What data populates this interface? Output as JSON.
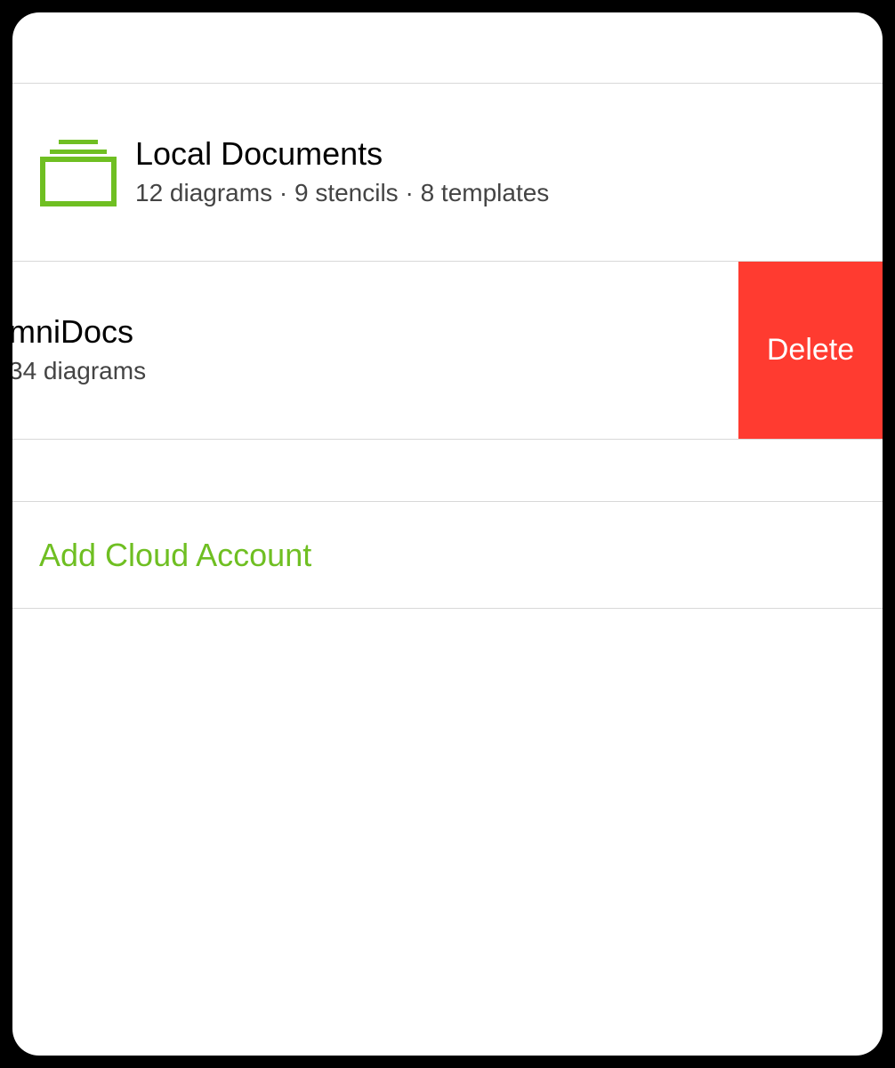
{
  "locations": {
    "local": {
      "title": "Local Documents",
      "subtitle": "12 diagrams · 9 stencils · 8 templates"
    },
    "swiped": {
      "title": "mniDocs",
      "subtitle": "34 diagrams",
      "delete_label": "Delete"
    }
  },
  "actions": {
    "add_cloud_label": "Add Cloud Account"
  },
  "colors": {
    "accent_green": "#6fbf22",
    "delete_red": "#ff3b30"
  }
}
